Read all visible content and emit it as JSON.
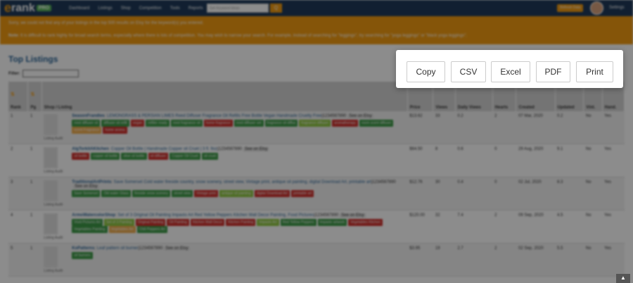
{
  "topbar": {
    "logo_text": "rank",
    "logo_badge": "PRO",
    "nav": [
      "Dashboard",
      "Listings",
      "Shop",
      "Competition",
      "Tools",
      "Reports"
    ],
    "search_placeholder": "Get Keyword Ideas",
    "search_button": "Q",
    "upgrade_label": "Refresh Data",
    "settings_label": "Settings"
  },
  "alert": {
    "line1": "Sorry, we could not find any of your listings in the top 500 results on Etsy for the keyword(s) you entered.",
    "line2_strong": "Note:",
    "line2": "It is difficult to rank highly for broad search terms, especially where there is lots of competition. You may wish to narrow your search. For example, instead of searching for \"leggings\", try searching for \"yoga leggings\" or \"black yoga leggings\"."
  },
  "main": {
    "title": "Top Listings",
    "filter_label": "Filter:"
  },
  "table": {
    "headers": [
      "Rank",
      "Pg",
      "Shop / Listing",
      "Price",
      "Views",
      "Daily Views",
      "Hearts",
      "Created",
      "Updated",
      "Vint.",
      "Hand."
    ],
    "audit_label": "Listing Audit",
    "etsy_label": "See on Etsy",
    "rows": [
      {
        "rank": "1",
        "pg": "1",
        "shop": "SeasonFrandles",
        "title": "LEMONGRASS & PERSIAN LIMES Reed Diffuser Fragrance Oil Refills Free Bottle Vegan Handmade Cruelty Free",
        "id": "|1234567890",
        "tags": [
          [
            "reed diffuser oil",
            "g"
          ],
          [
            "diffuser oil refill",
            "g"
          ],
          [
            "vegan",
            "r"
          ],
          [
            "refiller ready",
            "g"
          ],
          [
            "reed fragrance oil",
            "g"
          ],
          [
            "home fragrance",
            "r"
          ],
          [
            "reed diffuser set",
            "g"
          ],
          [
            "fragrance oil diffus",
            "g"
          ],
          [
            "fragrance diffuser",
            "lg"
          ],
          [
            "aromatherapy",
            "r"
          ],
          [
            "room scent diffuser",
            "g"
          ],
          [
            "scent Fragrance",
            "o"
          ],
          [
            "home aroma",
            "r"
          ]
        ],
        "price": "$13.62",
        "views": "33",
        "daily": "0.2",
        "hearts": "2",
        "created": "07 Mar, 2020",
        "updated": "0.2",
        "vint": "No",
        "hand": "Yes"
      },
      {
        "rank": "2",
        "pg": "1",
        "shop": "AlgTorkitAKitchen",
        "title": "Copper Oil Bottle | Handmade Copper oil Cruet | 3 fl. 9oz",
        "id": "|1234567890",
        "tags": [
          [
            "oil bottle",
            "r"
          ],
          [
            "copper oil bottle",
            "g"
          ],
          [
            "olive oil bottle",
            "g"
          ],
          [
            "oil diffuser",
            "r"
          ],
          [
            "Copper Oil Cruet",
            "g"
          ],
          [
            "oil cruet",
            "g"
          ]
        ],
        "price": "$64.50",
        "views": "8",
        "daily": "0.6",
        "hearts": "0",
        "created": "29 Aug, 2020",
        "updated": "9.1",
        "vint": "No",
        "hand": "Yes"
      },
      {
        "rank": "3",
        "pg": "1",
        "shop": "TraditionalArtPrints",
        "title": "Save Somerset Cold water fireside country, snow scenery, street view, Vintage print, antique oil painting, digital Download Art, printable art",
        "id": "|1234567890",
        "tags": [
          [
            "Save Somerset",
            "g"
          ],
          [
            "Old water Glass",
            "g"
          ],
          [
            "fireside snow scenery",
            "g"
          ],
          [
            "street view",
            "g"
          ],
          [
            "Vintage print",
            "r"
          ],
          [
            "antique oil painting",
            "lg"
          ],
          [
            "digital Download Art",
            "r"
          ],
          [
            "printable art",
            "r"
          ]
        ],
        "price": "$12.76",
        "views": "30",
        "daily": "0.4",
        "hearts": "0",
        "created": "02 Jul, 2020",
        "updated": "8.3",
        "vint": "No",
        "hand": "Yes"
      },
      {
        "rank": "4",
        "pg": "1",
        "shop": "ArmoWatercolorShop",
        "title": "Set of 3 Original Oil Painting Impasto Art Red Yellow Peppers Kitchen Wall Decor Painting, Food Pictures",
        "id": "|1234567890",
        "tags": [
          [
            "Vivid Pictures Art",
            "g"
          ],
          [
            "Set of 3 Painting",
            "lg"
          ],
          [
            "Original Painting",
            "r"
          ],
          [
            "Oil Painting",
            "r"
          ],
          [
            "Kitchen Wall Decor",
            "r"
          ],
          [
            "Kitchen Painting",
            "r"
          ],
          [
            "Impasto Art",
            "lg"
          ],
          [
            "Red Yellow Peppers",
            "g"
          ],
          [
            "Impasto artwork",
            "g"
          ],
          [
            "Vegetables Kitchen",
            "r"
          ],
          [
            "Vegetables Painting",
            "g"
          ],
          [
            "Vegetables Art",
            "o"
          ],
          [
            "Chili Peppers Art",
            "g"
          ]
        ],
        "price": "$120.00",
        "views": "32",
        "daily": "7.4",
        "hearts": "2",
        "created": "09 Sep, 2020",
        "updated": "4.5",
        "vint": "No",
        "hand": "Yes"
      },
      {
        "rank": "5",
        "pg": "1",
        "shop": "KoPatterns",
        "title": "Leaf pattern oil burner",
        "id": "|1234567890",
        "tags": [
          [
            "oil burners",
            "g"
          ]
        ],
        "price": "$3.95",
        "views": "19",
        "daily": "2.7",
        "hearts": "2",
        "created": "02 Sep, 2020",
        "updated": "5.5",
        "vint": "No",
        "hand": "Yes"
      }
    ]
  },
  "export_popup": {
    "copy": "Copy",
    "csv": "CSV",
    "excel": "Excel",
    "pdf": "PDF",
    "print": "Print"
  }
}
